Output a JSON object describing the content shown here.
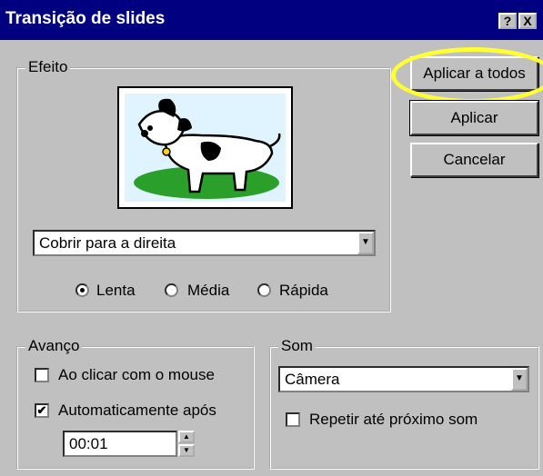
{
  "window": {
    "title": "Transição de slides",
    "help_button": "?",
    "close_button": "X"
  },
  "buttons": {
    "apply_all": "Aplicar a todos",
    "apply": "Aplicar",
    "cancel": "Cancelar"
  },
  "effect": {
    "group_label": "Efeito",
    "selected": "Cobrir para a direita",
    "speeds": [
      "Lenta",
      "Média",
      "Rápida"
    ],
    "selected_speed": "Lenta"
  },
  "advance": {
    "group_label": "Avanço",
    "on_click": {
      "label": "Ao clicar com o mouse",
      "checked": false
    },
    "automatic": {
      "label": "Automaticamente após",
      "checked": true
    },
    "time": "00:01"
  },
  "sound": {
    "group_label": "Som",
    "selected": "Câmera",
    "loop": {
      "label": "Repetir até próximo som",
      "checked": false
    }
  },
  "colors": {
    "titlebar": "#000080",
    "face": "#c0c0c0",
    "highlight": "#ffff33"
  }
}
